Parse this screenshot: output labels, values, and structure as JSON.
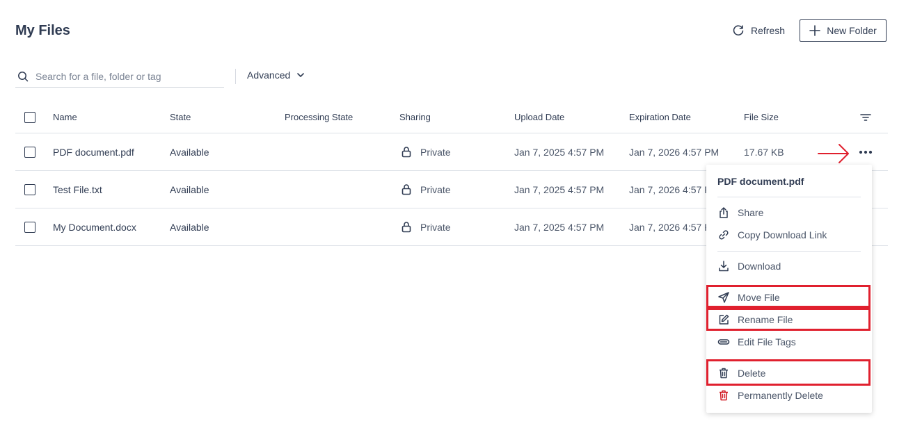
{
  "header": {
    "title": "My Files",
    "refresh_label": "Refresh",
    "new_folder_label": "New Folder"
  },
  "search": {
    "placeholder": "Search for a file, folder or tag",
    "value": "",
    "advanced_label": "Advanced"
  },
  "table": {
    "columns": {
      "name": "Name",
      "state": "State",
      "processing_state": "Processing State",
      "sharing": "Sharing",
      "upload_date": "Upload Date",
      "expiration_date": "Expiration Date",
      "file_size": "File Size"
    },
    "rows": [
      {
        "name": "PDF document.pdf",
        "state": "Available",
        "processing_state": "",
        "sharing": "Private",
        "upload_date": "Jan 7, 2025 4:57 PM",
        "expiration_date": "Jan 7, 2026 4:57 PM",
        "file_size": "17.67 KB"
      },
      {
        "name": "Test File.txt",
        "state": "Available",
        "processing_state": "",
        "sharing": "Private",
        "upload_date": "Jan 7, 2025 4:57 PM",
        "expiration_date": "Jan 7, 2026 4:57 PM",
        "file_size": ""
      },
      {
        "name": "My Document.docx",
        "state": "Available",
        "processing_state": "",
        "sharing": "Private",
        "upload_date": "Jan 7, 2025 4:57 PM",
        "expiration_date": "Jan 7, 2026 4:57 PM",
        "file_size": ""
      }
    ]
  },
  "context_menu": {
    "title": "PDF document.pdf",
    "items": {
      "share": "Share",
      "copy_link": "Copy Download Link",
      "download": "Download",
      "move": "Move File",
      "rename": "Rename File",
      "edit_tags": "Edit File Tags",
      "delete": "Delete",
      "permanently_delete": "Permanently Delete"
    }
  },
  "colors": {
    "text": "#2f3b52",
    "highlight": "#e0202e",
    "danger": "#d0161f",
    "divider": "#dde1e7"
  },
  "icons": [
    "refresh-icon",
    "plus-icon",
    "search-icon",
    "chevron-down-icon",
    "filter-icon",
    "lock-icon",
    "more-icon",
    "arrow-right-icon",
    "share-icon",
    "link-icon",
    "download-icon",
    "send-icon",
    "edit-icon",
    "tag-icon",
    "trash-icon"
  ]
}
